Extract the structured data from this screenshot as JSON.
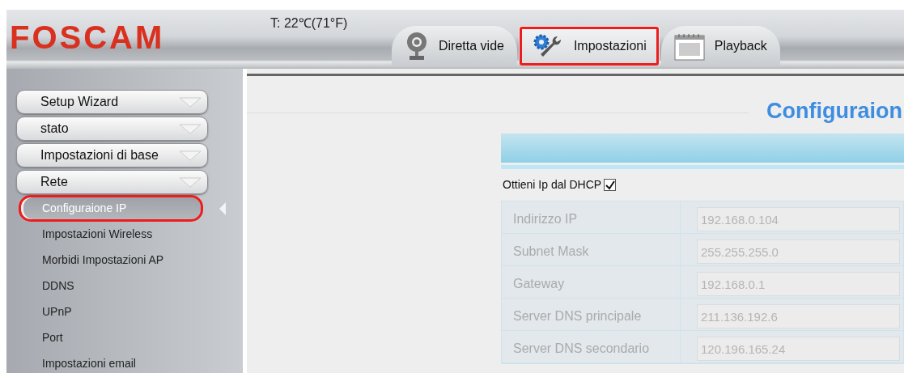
{
  "header": {
    "logo": "FOSCAM",
    "temperature": "T: 22℃(71°F)"
  },
  "tabs": [
    {
      "label": "Diretta vide",
      "kind": "webcam",
      "selected": false,
      "highlighted": false
    },
    {
      "label": "Impostazioni",
      "kind": "settings",
      "selected": true,
      "highlighted": true
    },
    {
      "label": "Playback",
      "kind": "calendar",
      "selected": false,
      "highlighted": false
    }
  ],
  "sidebar": {
    "groups": [
      {
        "label": "Setup Wizard"
      },
      {
        "label": "stato"
      },
      {
        "label": "Impostazioni di base"
      },
      {
        "label": "Rete",
        "children": [
          {
            "label": "Configuraione IP",
            "selected": true,
            "highlighted": true
          },
          {
            "label": "Impostazioni Wireless",
            "selected": false,
            "highlighted": false
          },
          {
            "label": "Morbidi Impostazioni AP",
            "selected": false,
            "highlighted": false
          },
          {
            "label": "DDNS",
            "selected": false,
            "highlighted": false
          },
          {
            "label": "UPnP",
            "selected": false,
            "highlighted": false
          },
          {
            "label": "Port",
            "selected": false,
            "highlighted": false
          },
          {
            "label": "Impostazioni email",
            "selected": false,
            "highlighted": false
          }
        ]
      }
    ]
  },
  "content": {
    "title": "Configuraion",
    "dhcp": {
      "label": "Ottieni Ip dal DHCP",
      "checked": true
    },
    "fields": [
      {
        "label": "Indirizzo IP",
        "value": "192.168.0.104",
        "disabled": true
      },
      {
        "label": "Subnet Mask",
        "value": "255.255.255.0",
        "disabled": true
      },
      {
        "label": "Gateway",
        "value": "192.168.0.1",
        "disabled": true
      },
      {
        "label": "Server DNS principale",
        "value": "211.136.192.6",
        "disabled": true
      },
      {
        "label": "Server DNS secondario",
        "value": "120.196.165.24",
        "disabled": true
      }
    ]
  }
}
